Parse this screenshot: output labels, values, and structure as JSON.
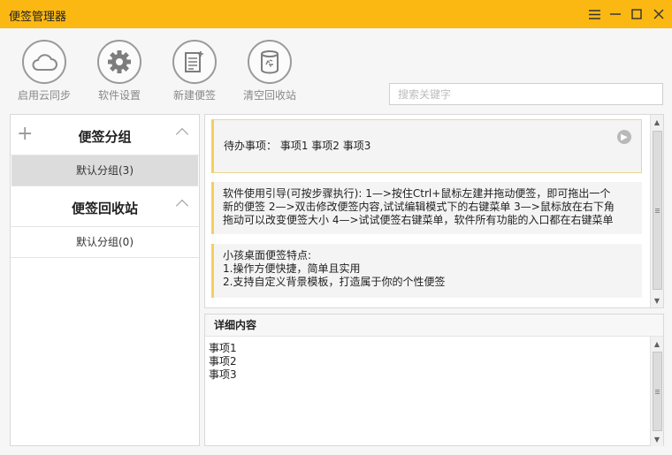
{
  "window": {
    "title": "便签管理器",
    "controls": [
      "menu-icon",
      "minimize-icon",
      "maximize-icon",
      "close-icon"
    ]
  },
  "toolbar": {
    "items": [
      {
        "label": "启用云同步",
        "icon": "cloud-icon"
      },
      {
        "label": "软件设置",
        "icon": "gear-icon"
      },
      {
        "label": "新建便签",
        "icon": "new-note-icon"
      },
      {
        "label": "清空回收站",
        "icon": "recycle-bin-icon"
      }
    ]
  },
  "search": {
    "placeholder": "搜索关键字",
    "value": ""
  },
  "sidebar": {
    "groups": [
      {
        "title": "便签分组",
        "items": [
          {
            "label": "默认分组(3)",
            "selected": true
          }
        ]
      },
      {
        "title": "便签回收站",
        "items": [
          {
            "label": "默认分组(0)",
            "selected": false
          }
        ]
      }
    ]
  },
  "notes": [
    {
      "lines": [
        "待办事项：  事项1  事项2  事项3"
      ]
    },
    {
      "lines": [
        "软件使用引导(可按步骤执行): 1—>按住Ctrl+鼠标左建并拖动便签，即可拖出一个",
        "新的便签 2—>双击修改便签内容,试试编辑模式下的右键菜单 3—>鼠标放在右下角",
        "拖动可以改变便签大小 4—>试试便签右键菜单，软件所有功能的入口都在右键菜单"
      ]
    },
    {
      "lines": [
        "小孩桌面便签特点:",
        "1.操作方便快捷，简单且实用",
        "2.支持自定义背景模板，打造属于你的个性便签"
      ]
    }
  ],
  "detail": {
    "title": "详细内容",
    "lines": [
      "事项1",
      "事项2",
      "事项3"
    ]
  },
  "colors": {
    "titlebar": "#fbb812",
    "note_accent": "#f3cf60"
  }
}
